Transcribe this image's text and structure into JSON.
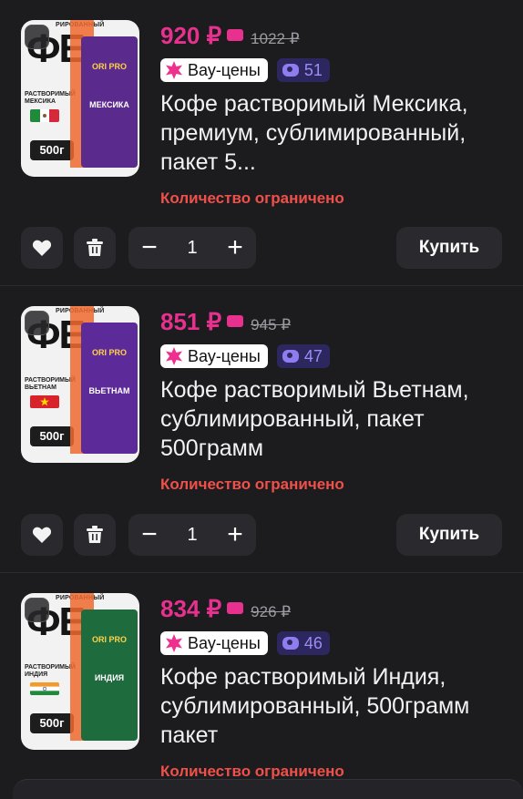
{
  "products": [
    {
      "price": "920 ₽",
      "old_price": "1022 ₽",
      "sale_label": "Вау-цены",
      "count": "51",
      "title": "Кофе растворимый Мексика, премиум, сублимированный, пакет 5...",
      "limited": "Количество ограничено",
      "image": {
        "banner": "РИРОВАННЫЙ",
        "big": "ФЕ",
        "country_label": "РАСТВОРИМЫЙ МЕКСИКА",
        "weight": "500г",
        "pack_logo": "ORI PRO",
        "pack_name": "МЕКСИКА",
        "pack_color": "#5a2a8c",
        "flag": "mexico"
      },
      "quantity": "1"
    },
    {
      "price": "851 ₽",
      "old_price": "945 ₽",
      "sale_label": "Вау-цены",
      "count": "47",
      "title": "Кофе растворимый Вьетнам, сублимированный, пакет 500грамм",
      "limited": "Количество ограничено",
      "image": {
        "banner": "РИРОВАННЫЙ",
        "big": "ФЕ",
        "country_label": "РАСТВОРИМЫЙ ВЬЕТНАМ",
        "weight": "500г",
        "pack_logo": "ORI PRO",
        "pack_name": "ВЬЕТНАМ",
        "pack_color": "#5d2a9a",
        "flag": "vietnam"
      },
      "quantity": "1"
    },
    {
      "price": "834 ₽",
      "old_price": "926 ₽",
      "sale_label": "Вау-цены",
      "count": "46",
      "title": "Кофе растворимый Индия, сублимированный, 500грамм пакет",
      "limited": "Количество ограничено",
      "image": {
        "banner": "РИРОВАННЫЙ",
        "big": "ФЕ",
        "country_label": "РАСТВОРИМЫЙ ИНДИЯ",
        "weight": "500г",
        "pack_logo": "ORI PRO",
        "pack_name": "ИНДИЯ",
        "pack_color": "#1e6b3e",
        "flag": "india"
      },
      "quantity": "1"
    }
  ],
  "controls": {
    "buy_label": "Купить",
    "minus": "−",
    "plus": "+"
  },
  "icons": {
    "like": "heart-icon",
    "delete": "trash-icon",
    "wallet": "wallet-icon",
    "sale": "star-burst-icon",
    "count": "eye-icon"
  },
  "colors": {
    "price": "#e8308f",
    "limited": "#f0504a",
    "count_badge_bg": "#2d2760",
    "count_badge_text": "#9c8cf5"
  }
}
